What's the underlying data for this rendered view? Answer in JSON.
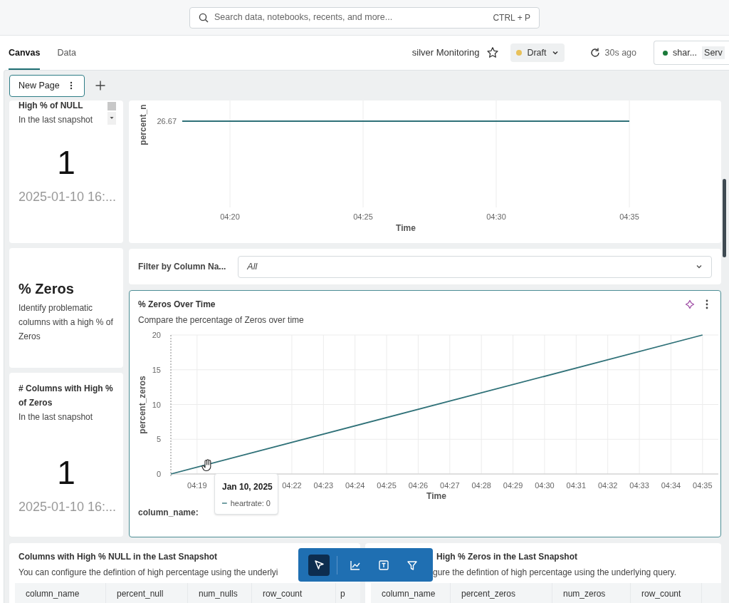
{
  "search": {
    "placeholder": "Search data, notebooks, recents, and more...",
    "shortcut": "CTRL + P"
  },
  "tabs": [
    {
      "label": "Canvas",
      "selected": true
    },
    {
      "label": "Data",
      "selected": false
    }
  ],
  "dashboard": {
    "title": "silver Monitoring",
    "starred": false,
    "status": "Draft",
    "refreshed": "30s ago",
    "compute": "shar...",
    "compute_badge": "Serv"
  },
  "pages": [
    {
      "label": "New Page",
      "selected": true
    }
  ],
  "null_counter": {
    "title": "High % of NULL",
    "subtitle": "In the last snapshot",
    "value": "1",
    "timestamp": "2025-01-10 16:..."
  },
  "null_chart": {
    "y_axis_title": "percent_n",
    "value_label": "26.67",
    "x_tick_labels": [
      "04:20",
      "04:25",
      "04:30",
      "04:35"
    ],
    "x_axis_title": "Time"
  },
  "zeros_text": {
    "heading": "% Zeros",
    "description": "Identify problematic columns with a high % of Zeros"
  },
  "filter": {
    "label": "Filter by Column Na...",
    "value": "All"
  },
  "zeros_chart": {
    "title": "% Zeros Over Time",
    "subtitle": "Compare the percentage of Zeros over time",
    "legend_label": "column_name:",
    "tooltip": {
      "title": "Jan 10, 2025",
      "entry": "heartrate: 0"
    },
    "chart_data": {
      "type": "line",
      "grid": true,
      "xlabel": "Time",
      "ylabel": "percent_zeros",
      "xlim": [
        258.17,
        275.5
      ],
      "ylim": [
        0,
        20
      ],
      "x": [
        258.17,
        275
      ],
      "series": [
        {
          "color": "#2f7178",
          "values": [
            0,
            20
          ]
        }
      ],
      "xticks": [
        {
          "value": 259,
          "label": "04:19"
        },
        {
          "value": 262,
          "label": "04:22"
        },
        {
          "value": 263,
          "label": "04:23"
        },
        {
          "value": 264,
          "label": "04:24"
        },
        {
          "value": 265,
          "label": "04:25"
        },
        {
          "value": 266,
          "label": "04:26"
        },
        {
          "value": 267,
          "label": "04:27"
        },
        {
          "value": 268,
          "label": "04:28"
        },
        {
          "value": 269,
          "label": "04:29"
        },
        {
          "value": 270,
          "label": "04:30"
        },
        {
          "value": 271,
          "label": "04:31"
        },
        {
          "value": 272,
          "label": "04:32"
        },
        {
          "value": 273,
          "label": "04:33"
        },
        {
          "value": 274,
          "label": "04:34"
        },
        {
          "value": 275,
          "label": "04:35"
        }
      ],
      "yticks": [
        0,
        5,
        10,
        15,
        20
      ]
    }
  },
  "zeros_counter": {
    "title": "# Columns with High % of Zeros",
    "subtitle": "In the last snapshot",
    "value": "1",
    "timestamp": "2025-01-10 16:..."
  },
  "tables": [
    {
      "title": "Columns with High % NULL in the Last Snapshot",
      "description": "You can configure the defintion of high percentage using the underlyi",
      "columns": [
        "column_name",
        "percent_null",
        "num_nulls",
        "row_count",
        "p"
      ]
    },
    {
      "title": "High % Zeros in the Last Snapshot",
      "description": "gure the defintion of high percentage using the underlying query.",
      "columns": [
        "column_name",
        "percent_zeros",
        "num_zeros",
        "row_count"
      ]
    }
  ],
  "toolbar": [
    {
      "kind": "select",
      "selected": true
    },
    {
      "kind": "chart",
      "selected": false
    },
    {
      "kind": "text",
      "selected": false
    },
    {
      "kind": "filter",
      "selected": false
    }
  ]
}
